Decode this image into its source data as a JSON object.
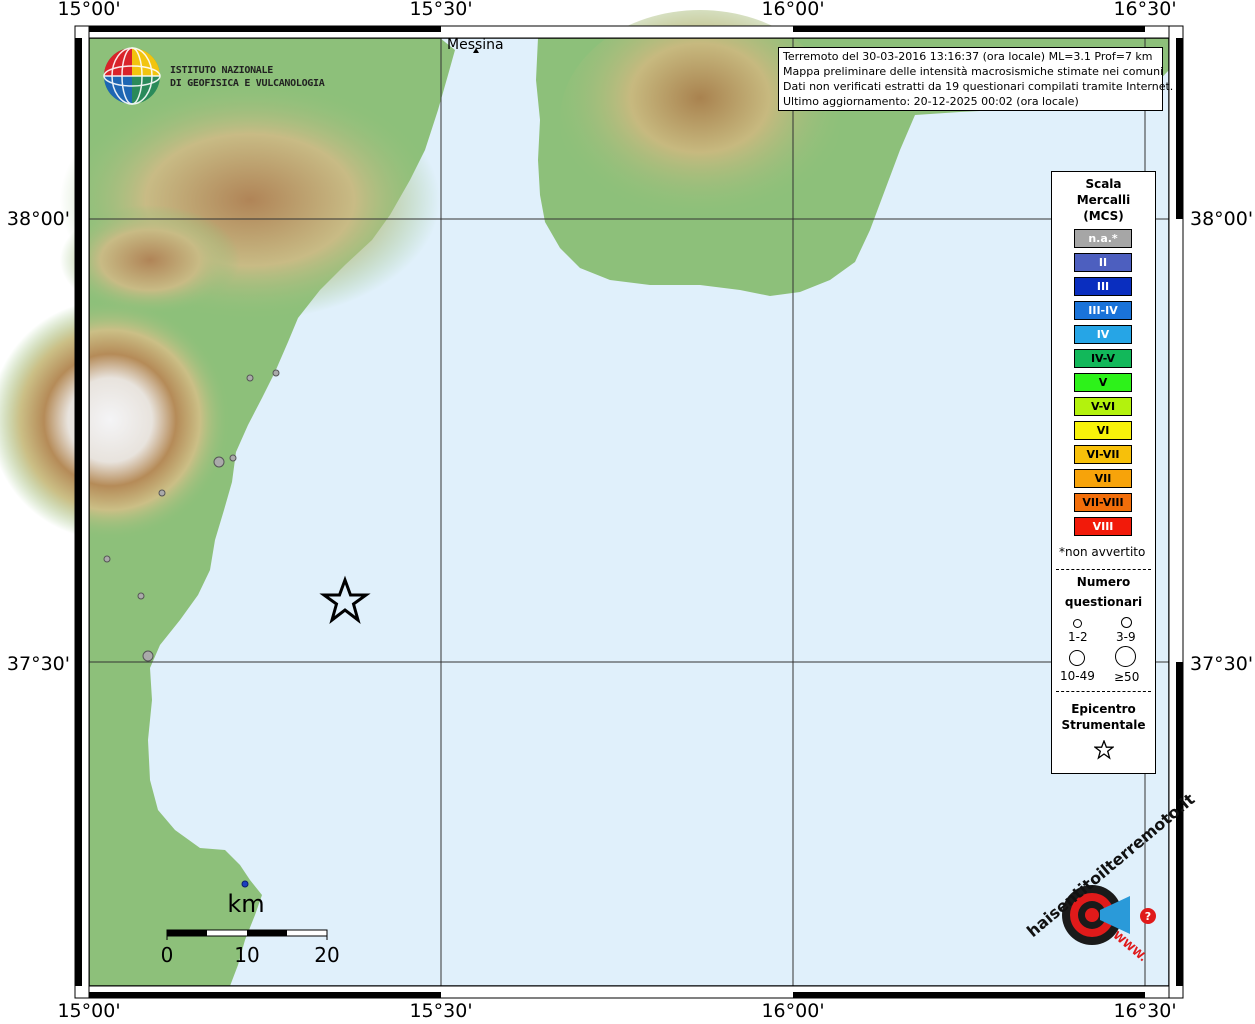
{
  "map": {
    "ticks": {
      "longitudes": [
        "15°00'",
        "15°30'",
        "16°00'",
        "16°30'"
      ],
      "latitudes": [
        "38°00'",
        "37°30'"
      ]
    },
    "place_label": "Messina",
    "colors": {
      "sea": "#e0f0fb",
      "lowland": "#8dc07a",
      "hills": "#c9c189",
      "mountains": "#b08a5a",
      "peak": "#f2f2f2",
      "grid": "#333333"
    }
  },
  "logo": {
    "line1": "ISTITUTO NAZIONALE",
    "line2": "DI GEOFISICA E VULCANOLOGIA"
  },
  "info": {
    "line1": "Terremoto del 30-03-2016 13:16:37 (ora locale) ML=3.1 Prof=7 km",
    "line2": "Mappa preliminare delle intensità macrosismiche stimate nei comuni",
    "line3": "Dati non verificati estratti da 19 questionari compilati tramite Internet.",
    "line4": "Ultimo aggiornamento: 20-12-2025 00:02 (ora locale)"
  },
  "legend": {
    "title": [
      "Scala",
      "Mercalli",
      "(MCS)"
    ],
    "classes": [
      {
        "label": "n.a.*",
        "color": "#a6a6a6",
        "text": "#ffffff"
      },
      {
        "label": "II",
        "color": "#4d5fbf",
        "text": "#ffffff"
      },
      {
        "label": "III",
        "color": "#0a2ebf",
        "text": "#ffffff"
      },
      {
        "label": "III-IV",
        "color": "#1a73d9",
        "text": "#ffffff"
      },
      {
        "label": "IV",
        "color": "#26a5e6",
        "text": "#ffffff"
      },
      {
        "label": "IV-V",
        "color": "#12b85a",
        "text": "#000000"
      },
      {
        "label": "V",
        "color": "#2df21a",
        "text": "#000000"
      },
      {
        "label": "V-VI",
        "color": "#b3f20d",
        "text": "#000000"
      },
      {
        "label": "VI",
        "color": "#f7f20a",
        "text": "#000000"
      },
      {
        "label": "VI-VII",
        "color": "#f7c00a",
        "text": "#000000"
      },
      {
        "label": "VII",
        "color": "#f7a30a",
        "text": "#000000"
      },
      {
        "label": "VII-VIII",
        "color": "#f26e0a",
        "text": "#000000"
      },
      {
        "label": "VIII",
        "color": "#f21a0a",
        "text": "#ffffff"
      }
    ],
    "note": "*non avvertito",
    "count_title": [
      "Numero",
      "questionari"
    ],
    "counts": [
      "1-2",
      "3-9",
      "10-49",
      "≥50"
    ],
    "epicenter_title": [
      "Epicentro",
      "Strumentale"
    ]
  },
  "scalebar": {
    "unit": "km",
    "labels": [
      "0",
      "10",
      "20"
    ]
  },
  "brand": {
    "text": "haisentitoilterremoto.it",
    "url_text": "WWW."
  }
}
